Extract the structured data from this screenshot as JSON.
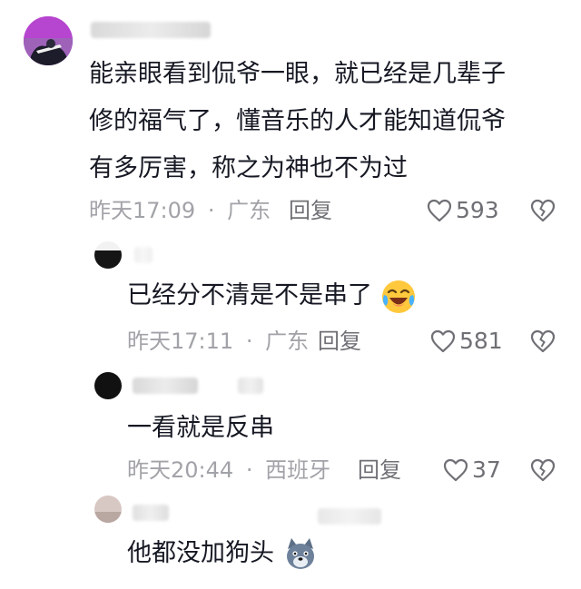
{
  "comments": [
    {
      "text_lines": [
        "能亲眼看到侃爷一眼，就已经是几辈子",
        "修的福气了，懂音乐的人才能知道侃爷",
        "有多厉害，称之为神也不为过"
      ],
      "time": "昨天17:09",
      "location": "广东",
      "reply_label": "回复",
      "likes": "593"
    },
    {
      "text": "已经分不清是不是串了",
      "emoji": "laughing-crying-emoji",
      "time": "昨天17:11",
      "location": "广东",
      "reply_label": "回复",
      "likes": "581"
    },
    {
      "text": "一看就是反串",
      "time": "昨天20:44",
      "location": "西班牙",
      "reply_label": "回复",
      "likes": "37"
    },
    {
      "text": "他都没加狗头",
      "emoji": "dog-head-emoji"
    }
  ],
  "separator": "·",
  "colors": {
    "text": "#161823",
    "meta": "#a2a3a8",
    "action": "#6f7075",
    "avatar_purple": "#b645cf"
  },
  "icons": {
    "like": "heart-outline-icon",
    "dislike": "broken-heart-icon"
  }
}
